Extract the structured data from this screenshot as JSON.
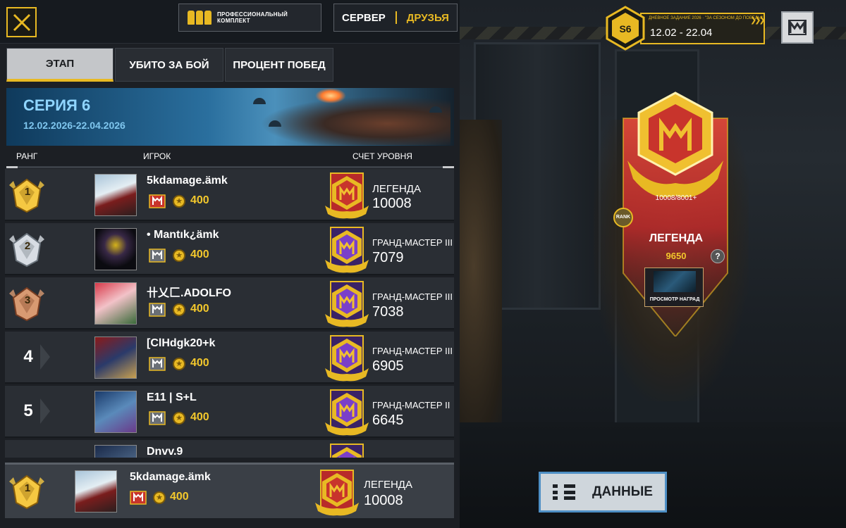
{
  "top": {
    "pro_kit_label": "ПРОФЕССИОНАЛЬНЫЙ КОМПЛЕКТ",
    "server_tab": "СЕРВЕР",
    "friends_tab": "ДРУЗЬЯ",
    "active_scope": "ДРУЗЬЯ"
  },
  "tabs": [
    "ЭТАП",
    "УБИТО ЗА БОЙ",
    "ПРОЦЕНТ ПОБЕД"
  ],
  "active_tab": "ЭТАП",
  "banner": {
    "title": "СЕРИЯ 6",
    "dates": "12.02.2026-22.04.2026"
  },
  "columns": {
    "rank": "РАНГ",
    "player": "ИГРОК",
    "score": "СЧЕТ УРОВНЯ"
  },
  "rows": [
    {
      "rank": "1",
      "medal": "gold",
      "name": "5kdamage.ämk",
      "points": "400",
      "tier": "ЛЕГЕНДА",
      "score": "10008",
      "badge": "legend"
    },
    {
      "rank": "2",
      "medal": "silver",
      "name": "• Mantık¿ämk",
      "points": "400",
      "tier": "ГРАНД-МАСТЕР III",
      "score": "7079",
      "badge": "grandmaster"
    },
    {
      "rank": "3",
      "medal": "bronze",
      "name": "卄乂匚.ADOLFO",
      "points": "400",
      "tier": "ГРАНД-МАСТЕР III",
      "score": "7038",
      "badge": "grandmaster"
    },
    {
      "rank": "4",
      "medal": "none",
      "name": "[ClHdgk20+k",
      "points": "400",
      "tier": "ГРАНД-МАСТЕР III",
      "score": "6905",
      "badge": "grandmaster"
    },
    {
      "rank": "5",
      "medal": "none",
      "name": "E11 | S+L",
      "points": "400",
      "tier": "ГРАНД-МАСТЕР II",
      "score": "6645",
      "badge": "grandmaster"
    },
    {
      "rank": "",
      "medal": "none",
      "name": "Dnvv.9",
      "points": "",
      "tier": "",
      "score": "",
      "badge": "grandmaster"
    }
  ],
  "self_row": {
    "rank": "1",
    "name": "5kdamage.ämk",
    "points": "400",
    "tier": "ЛЕГЕНДА",
    "score": "10008"
  },
  "event": {
    "label": "ДНЕВНОЕ ЗАДАНИЕ 2026 · \"ЗА СЕЗОНОМ ДО ПОБЕДЫ\"",
    "badge": "S6",
    "dates": "12.02 - 22.04"
  },
  "rank_card": {
    "progress": "10008/8001+",
    "small_icon": "RANK",
    "name": "ЛЕГЕНДА",
    "points": "9650",
    "help": "?",
    "rewards_label": "ПРОСМОТР НАГРАД"
  },
  "data_button": "ДАННЫЕ",
  "colors": {
    "accent": "#e8b923",
    "panel": "#1c1f24",
    "row": "#2a2e34",
    "legend_red": "#c72c2c",
    "gm_purple": "#7a3fc9"
  },
  "icons": {
    "close": "close-icon",
    "menu": "menu-icon",
    "list": "list-icon",
    "coin": "star-coin-icon",
    "kit": "ammo-kit-icon"
  }
}
